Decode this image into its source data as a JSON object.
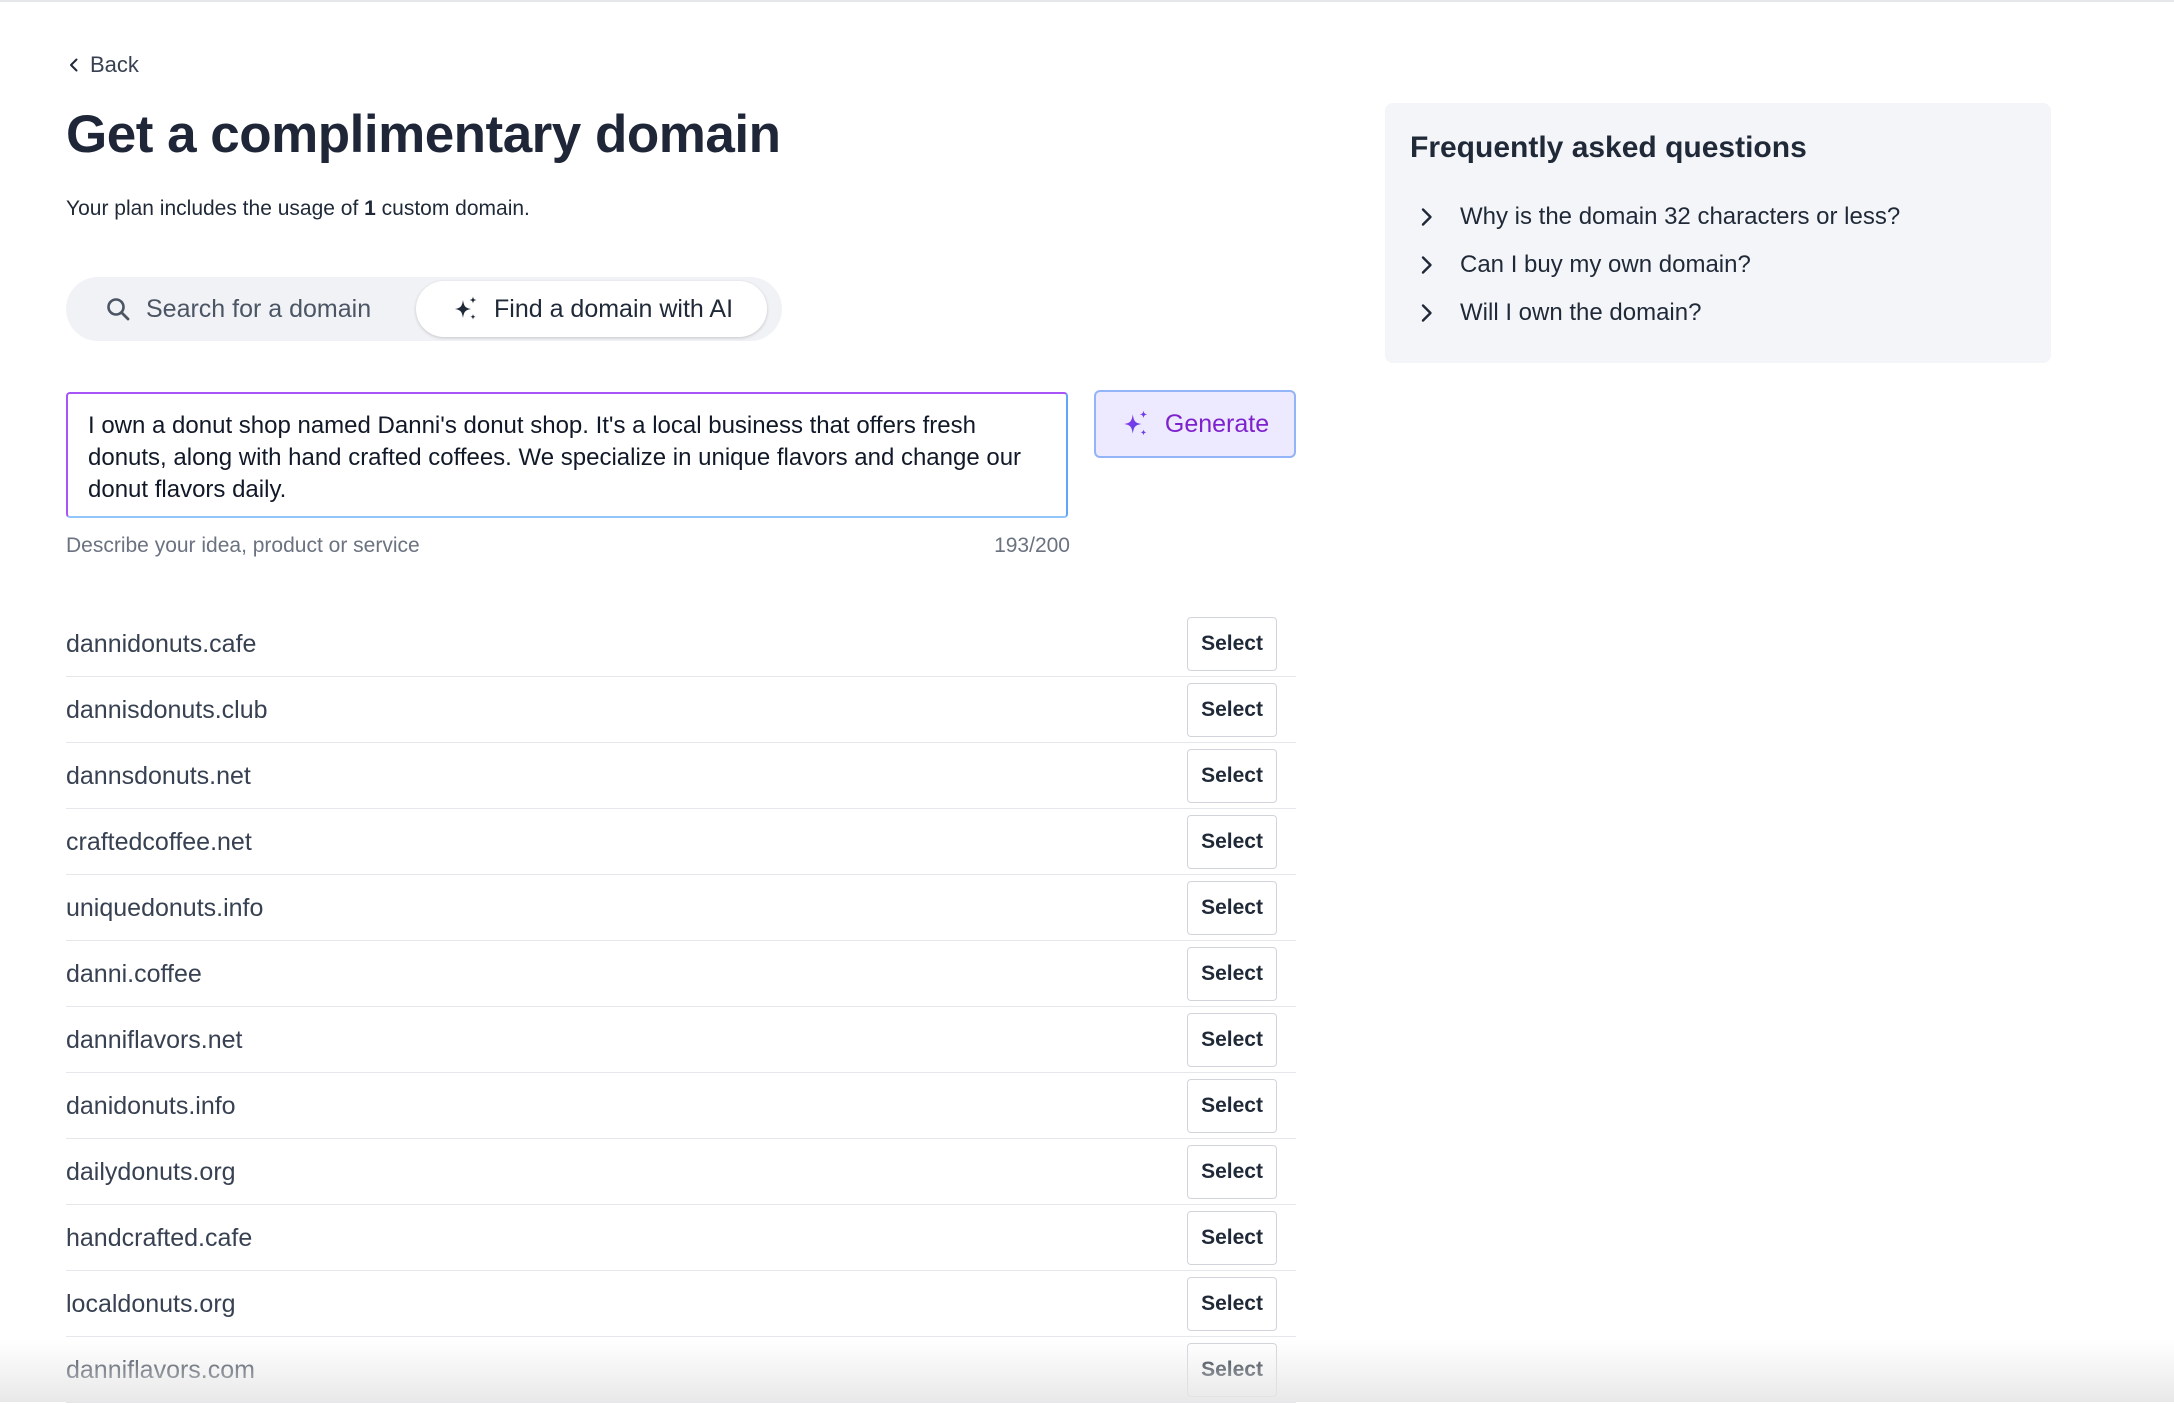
{
  "nav": {
    "back_label": "Back"
  },
  "header": {
    "title": "Get a complimentary domain",
    "subtitle_pre": "Your plan includes the usage of ",
    "subtitle_count": "1",
    "subtitle_post": " custom domain."
  },
  "tabs": [
    {
      "label": "Search for a domain",
      "icon": "search-icon",
      "selected": false
    },
    {
      "label": "Find a domain with AI",
      "icon": "sparkle-icon",
      "selected": true
    }
  ],
  "prompt": {
    "value": "I own a donut shop named Danni's donut shop. It's a local business that offers fresh donuts, along with hand crafted coffees. We specialize in unique flavors and change our donut flavors daily.",
    "helper": "Describe your idea, product or service",
    "counter": "193/200"
  },
  "generate_label": "Generate",
  "select_label": "Select",
  "results": [
    "dannidonuts.cafe",
    "dannisdonuts.club",
    "dannsdonuts.net",
    "craftedcoffee.net",
    "uniquedonuts.info",
    "danni.coffee",
    "danniflavors.net",
    "danidonuts.info",
    "dailydonuts.org",
    "handcrafted.cafe",
    "localdonuts.org",
    "danniflavors.com"
  ],
  "faq": {
    "title": "Frequently asked questions",
    "items": [
      "Why is the domain 32 characters or less?",
      "Can I buy my own domain?",
      "Will I own the domain?"
    ]
  },
  "colors": {
    "accent_purple": "#7e22ce",
    "title": "#1e2638"
  }
}
